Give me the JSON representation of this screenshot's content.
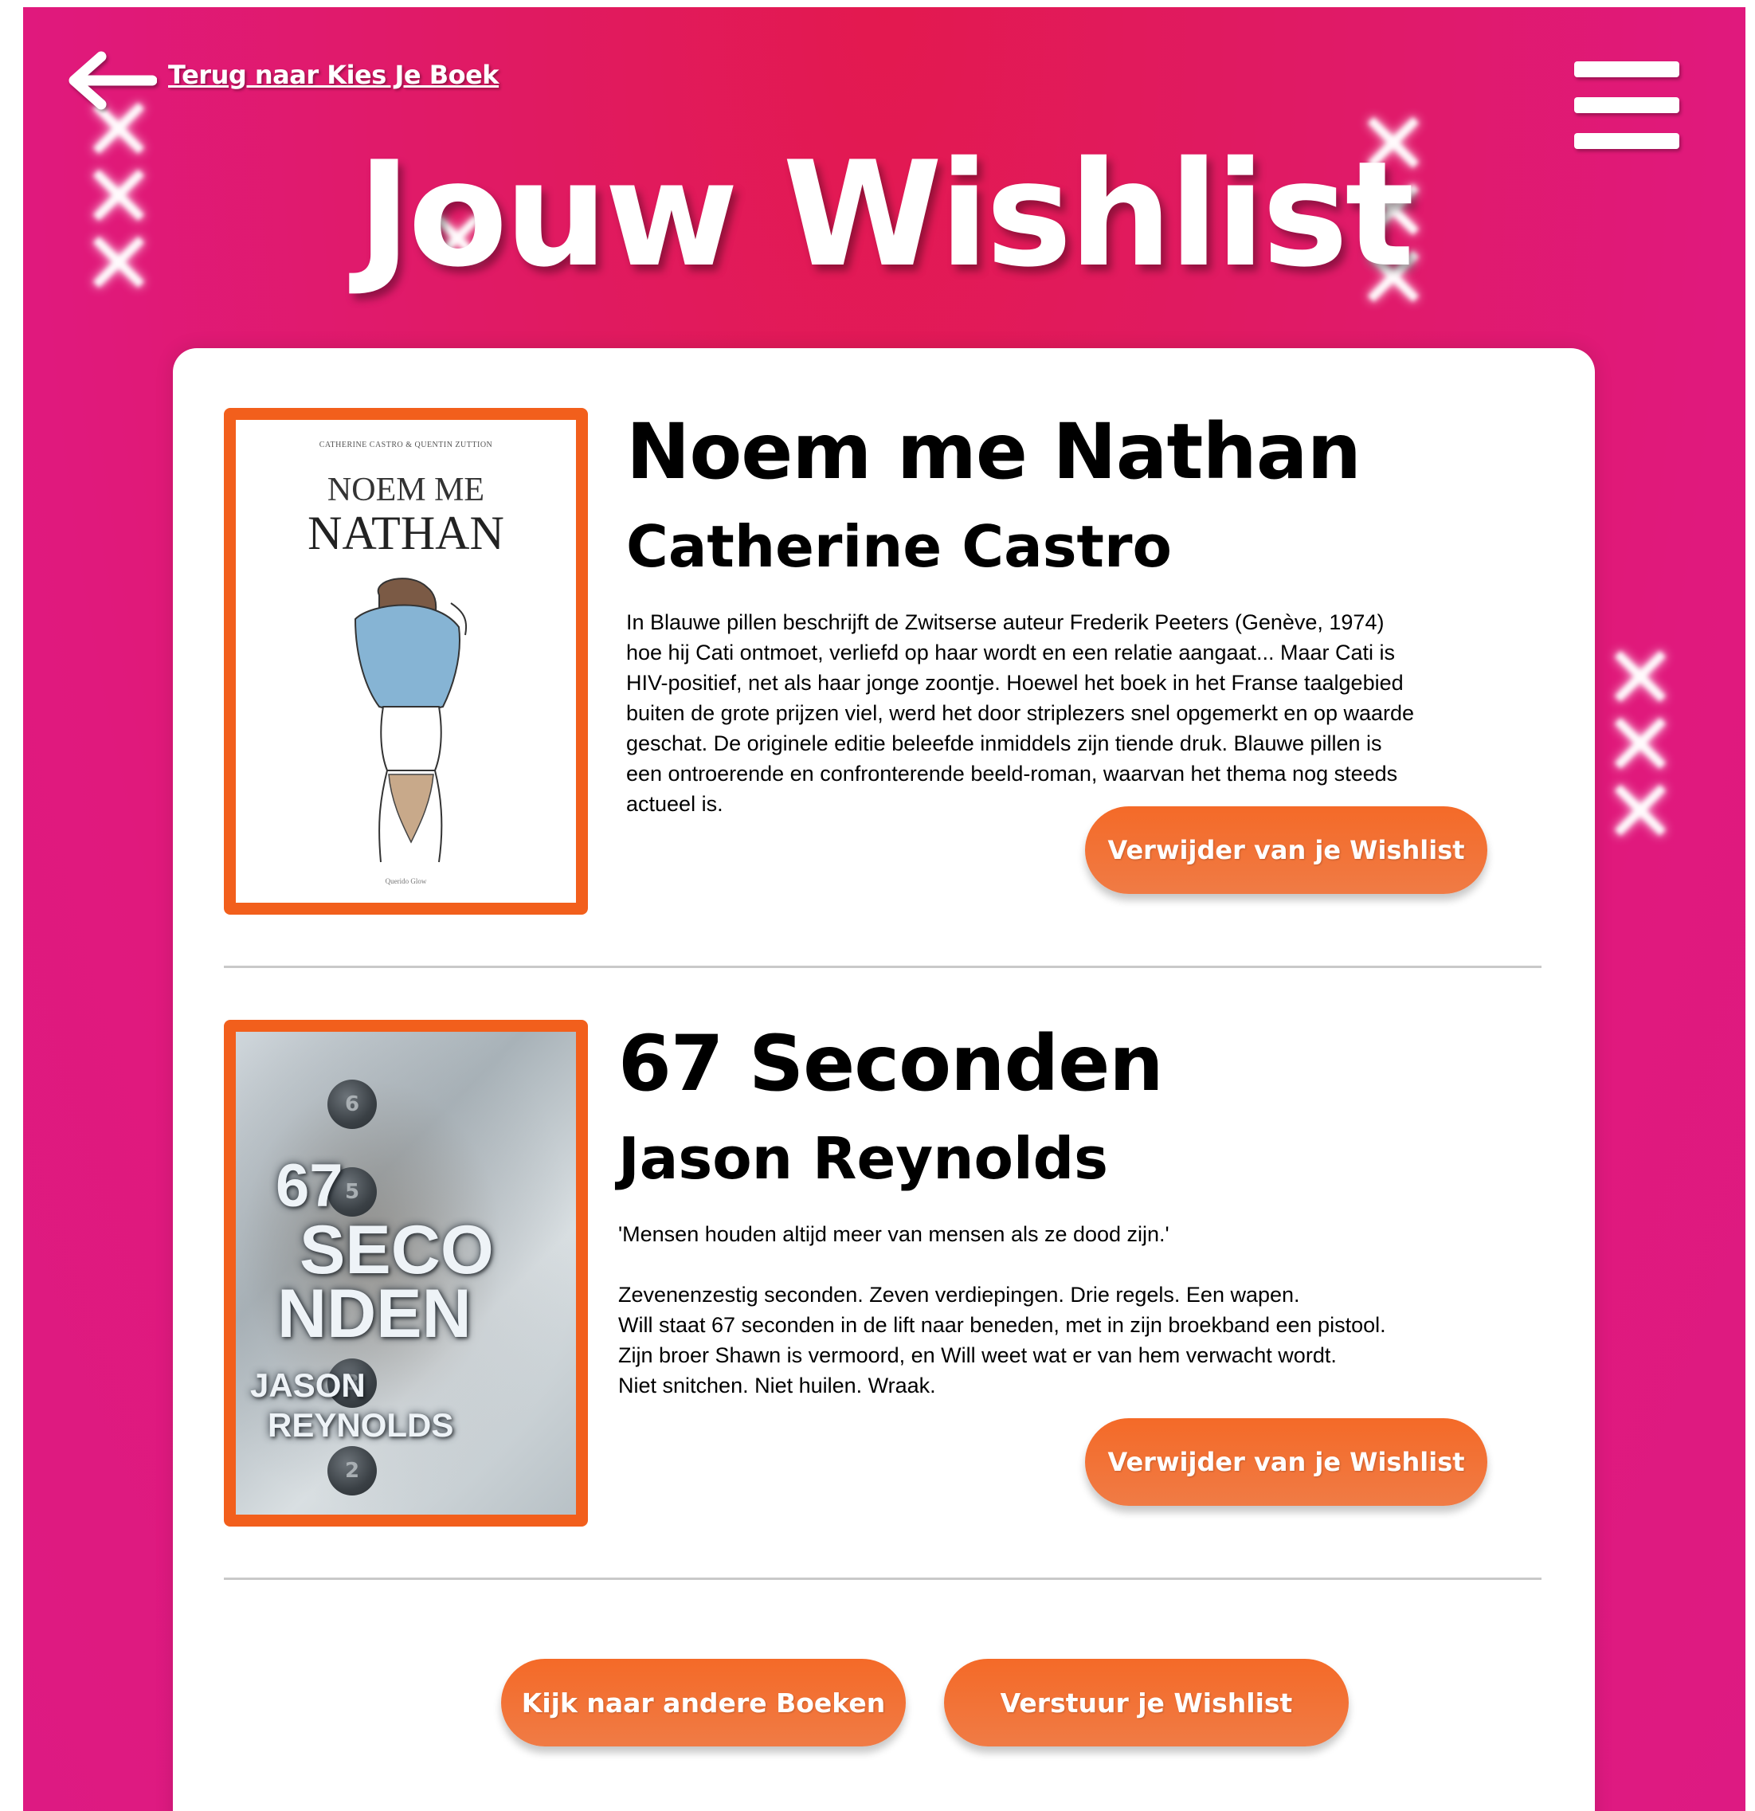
{
  "header": {
    "back_label": "Terug naar Kies Je Boek",
    "page_title": "Jouw Wishlist"
  },
  "books": [
    {
      "title": "Noem me Nathan",
      "author": "Catherine Castro",
      "description": "In Blauwe pillen beschrijft de Zwitserse auteur Frederik Peeters (Genève, 1974) hoe hij Cati ontmoet, verliefd op haar wordt en een relatie aangaat... Maar Cati is HIV-positief, net als haar jonge zoontje. Hoewel het boek in het Franse taalgebied buiten de grote prijzen viel, werd het door striplezers snel opgemerkt en op waarde geschat. De originele editie beleefde inmiddels zijn tiende druk. Blauwe pillen is een ontroerende en confronterende beeld-roman, waarvan het thema nog steeds actueel is.",
      "remove_label": "Verwijder van je Wishlist",
      "cover": {
        "authors": "CATHERINE CASTRO & QUENTIN ZUTTION",
        "line1": "NOEM ME",
        "line2": "NATHAN",
        "publisher": "Querido Glow"
      }
    },
    {
      "title": "67 Seconden",
      "author": "Jason Reynolds",
      "description": "'Mensen houden altijd meer van mensen als ze dood zijn.'\n\nZevenenzestig seconden. Zeven verdiepingen. Drie regels. Een wapen.\nWill staat 67 seconden in de lift naar beneden, met in zijn broekband een pistool. Zijn broer Shawn is vermoord, en Will weet wat er van hem verwacht wordt.\nNiet snitchen. Niet huilen. Wraak.",
      "remove_label": "Verwijder van je Wishlist",
      "cover": {
        "num": "67",
        "line1": "SECO",
        "line2": "NDEN",
        "author1": "JASON",
        "author2": "REYNOLDS"
      }
    }
  ],
  "footer": {
    "browse_label": "Kijk naar andere Boeken",
    "send_label": "Verstuur je Wishlist"
  },
  "colors": {
    "background": "#e0197d",
    "accent": "#f25f1c",
    "card": "#ffffff"
  },
  "icons": {
    "back": "arrow-left-icon",
    "menu": "hamburger-menu-icon",
    "decor": "xxx-amsterdam-icon"
  }
}
